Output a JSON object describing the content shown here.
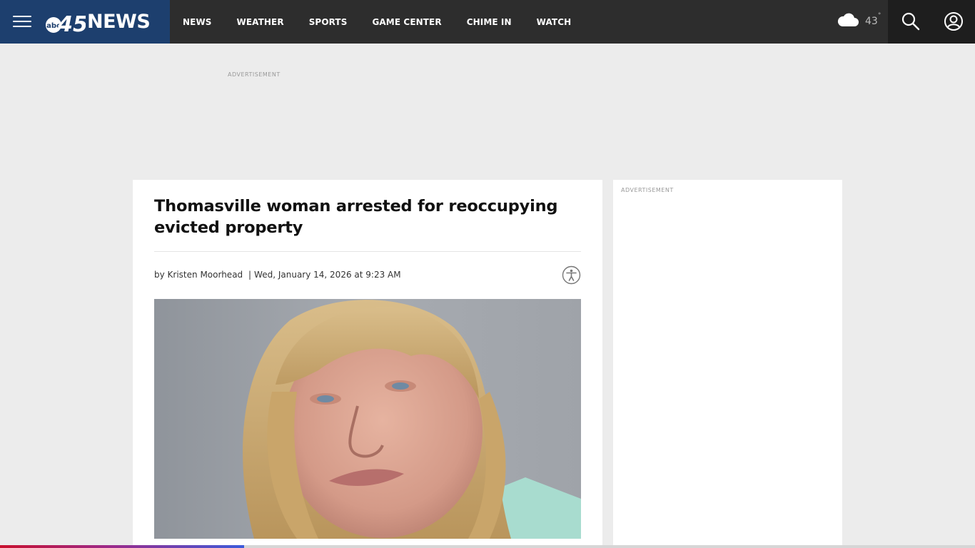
{
  "brand": {
    "logo_mark": "abc",
    "logo_number": "45",
    "logo_word": "NEWS",
    "colors": {
      "brand_bg": "#1d3f6e",
      "header_bg": "#2d2d2d",
      "tools_bg": "#1e1e1e"
    }
  },
  "nav": {
    "items": [
      {
        "label": "NEWS"
      },
      {
        "label": "WEATHER"
      },
      {
        "label": "SPORTS"
      },
      {
        "label": "GAME CENTER"
      },
      {
        "label": "CHIME IN"
      },
      {
        "label": "WATCH"
      }
    ]
  },
  "weather": {
    "icon": "cloud-icon",
    "temp": "43",
    "degree": "°"
  },
  "tools": {
    "search_icon": "search-icon",
    "account_icon": "account-icon"
  },
  "ads": {
    "top_label": "ADVERTISEMENT",
    "side_label": "ADVERTISEMENT"
  },
  "article": {
    "headline": "Thomasville woman arrested for reoccupying evicted property",
    "byline": {
      "prefix": "by",
      "author": "Kristen Moorhead",
      "separator": "|",
      "date": "Wed, January 14, 2026 at 9:23 AM"
    },
    "accessibility_icon": "accessibility-icon"
  },
  "reading_progress": {
    "fraction": 0.25,
    "colors": [
      "#c8102e",
      "#9c2a8a",
      "#3b5bdb"
    ]
  }
}
